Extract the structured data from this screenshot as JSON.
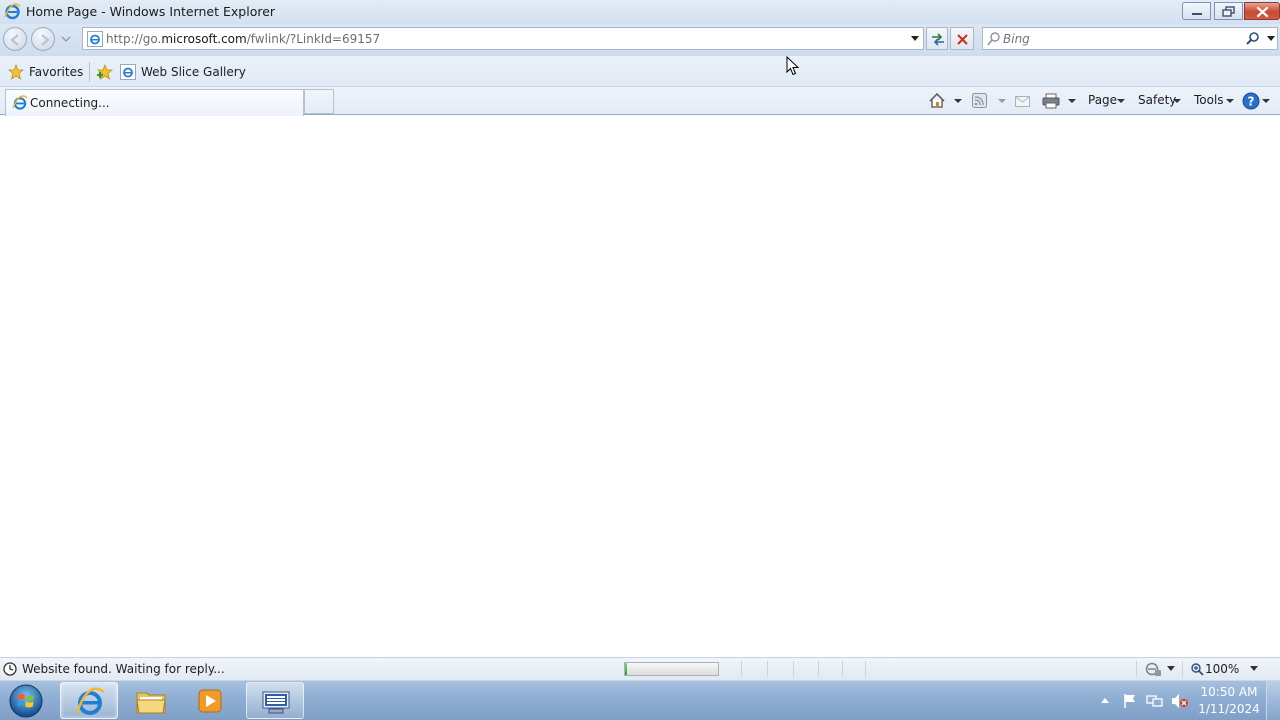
{
  "window": {
    "title": "Home Page - Windows Internet Explorer"
  },
  "navigation": {
    "address_url_prefix": "http://go.",
    "address_url_domain": "microsoft.com",
    "address_url_path": "/fwlink/?LinkId=69157",
    "search_placeholder": "Bing"
  },
  "favorites_bar": {
    "favorites_label": "Favorites",
    "items": [
      {
        "label": "Web Slice Gallery"
      }
    ]
  },
  "tabs": [
    {
      "label": "Connecting...",
      "active": true
    }
  ],
  "command_bar": {
    "page_label": "Page",
    "safety_label": "Safety",
    "tools_label": "Tools"
  },
  "status_bar": {
    "status_text": "Website found. Waiting for reply...",
    "progress": 0.02,
    "zoom_label": "100%"
  },
  "taskbar": {
    "clock_time": "10:50 AM",
    "clock_date": "1/11/2024",
    "pinned_apps": [
      "internet-explorer",
      "windows-explorer",
      "windows-media-player",
      "remote-desktop"
    ]
  },
  "colors": {
    "chrome_blue": "#dce7f4",
    "taskbar_blue": "#8eaed3",
    "close_red": "#c84a32",
    "progress_green": "#2aa42c"
  }
}
